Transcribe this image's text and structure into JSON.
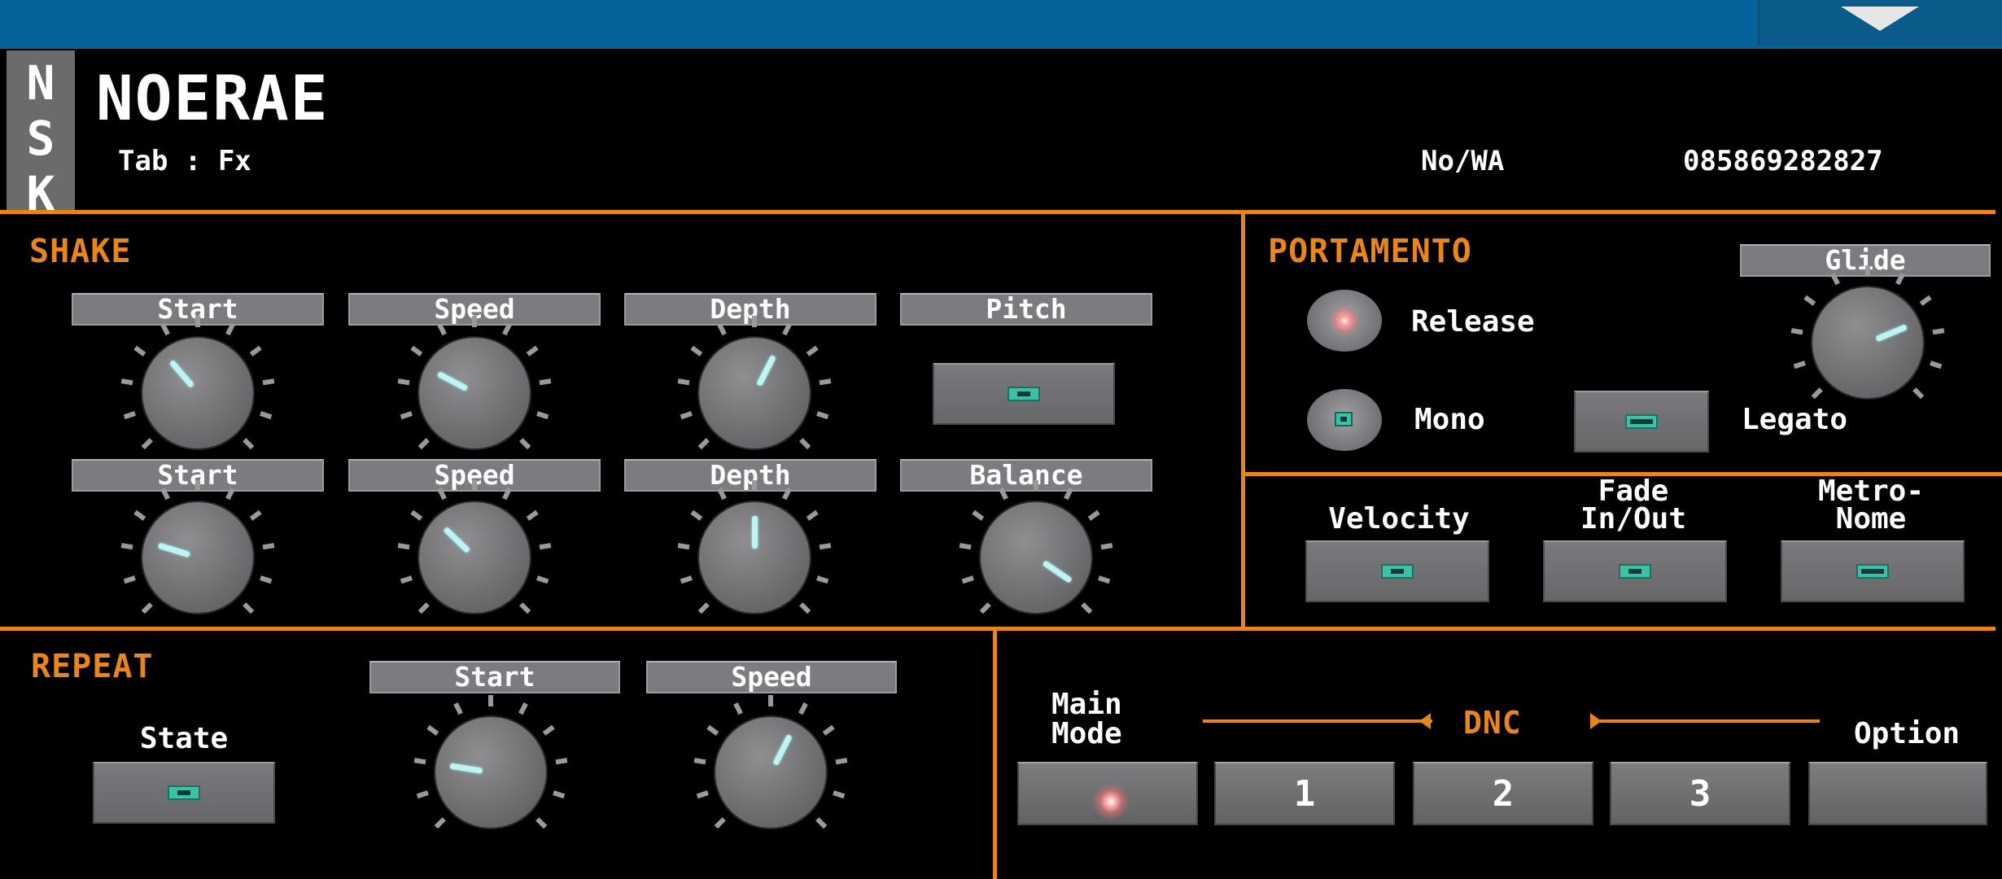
{
  "app": {
    "logo_letters": [
      "N",
      "S",
      "K"
    ],
    "brand": "NOERAE",
    "tab_info": "Tab : Fx",
    "contact_label": "No/WA",
    "contact_phone": "085869282827"
  },
  "colors": {
    "accent": "#e8861a",
    "topbar": "#05639a",
    "led": "#3cc1a8",
    "indicator": "#bff4f4"
  },
  "shake": {
    "title": "SHAKE",
    "row1": {
      "start": "Start",
      "speed": "Speed",
      "depth": "Depth",
      "pitch": "Pitch"
    },
    "row2": {
      "start": "Start",
      "speed": "Speed",
      "depth": "Depth",
      "balance": "Balance"
    }
  },
  "portamento": {
    "title": "PORTAMENTO",
    "glide": "Glide",
    "release": "Release",
    "mono": "Mono",
    "legato": "Legato"
  },
  "toggles": {
    "velocity": "Velocity",
    "fade_1": "Fade",
    "fade_2": "In/Out",
    "metro_1": "Metro-",
    "metro_2": "Nome"
  },
  "repeat": {
    "title": "REPEAT",
    "state": "State",
    "start": "Start",
    "speed": "Speed"
  },
  "mode": {
    "main_1": "Main",
    "main_2": "Mode",
    "dnc": "DNC",
    "option": "Option",
    "btn1": "1",
    "btn2": "2",
    "btn3": "3"
  }
}
